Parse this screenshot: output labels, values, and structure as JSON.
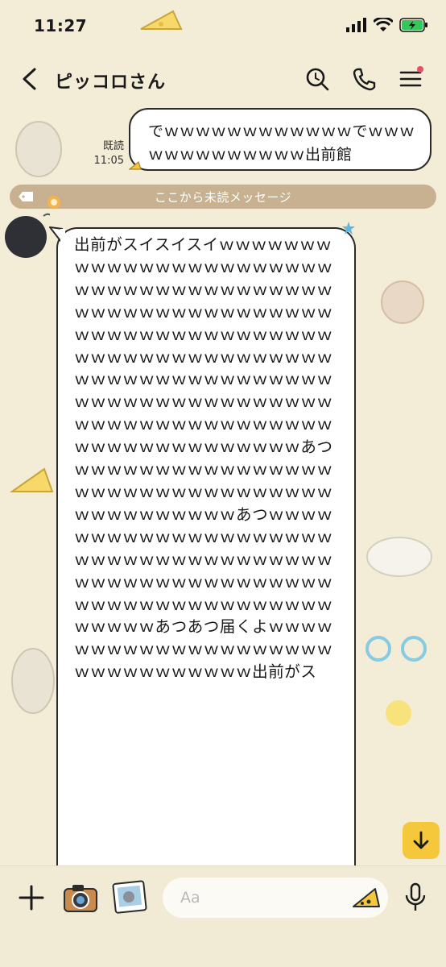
{
  "status_bar": {
    "time": "11:27",
    "battery_color": "#34c759"
  },
  "header": {
    "title": "ピッコロさん",
    "icons": [
      "chevron-left-icon",
      "search-icon",
      "phone-icon",
      "menu-icon"
    ],
    "notification_color": "#e8506a"
  },
  "messages": {
    "sent": {
      "text": "でｗｗｗｗｗｗｗｗｗｗｗｗでｗｗｗｗｗｗｗｗｗｗｗｗｗ出前館",
      "read_label": "既読",
      "time": "11:05"
    },
    "unread_divider": "ここから未読メッセージ",
    "received": {
      "text": "出前がスイスイスイｗｗｗｗｗｗｗｗｗｗｗｗｗｗｗｗｗｗｗｗｗｗｗｗｗｗｗｗｗｗｗｗｗｗｗｗｗｗｗｗｗｗｗｗｗｗｗｗｗｗｗｗｗｗｗｗｗｗｗｗｗｗｗｗｗｗｗｗｗｗｗｗｗｗｗｗｗｗｗｗｗｗｗｗｗｗｗｗｗｗｗｗｗｗｗｗｗｗｗｗｗｗｗｗｗｗｗｗｗｗｗｗｗｗｗｗｗｗｗｗｗｗｗｗｗｗｗｗｗｗｗｗｗｗｗｗｗｗｗｗｗｗｗｗｗｗｗｗｗあつｗｗｗｗｗｗｗｗｗｗｗｗｗｗｗｗｗｗｗｗｗｗｗｗｗｗｗｗｗｗｗｗｗｗｗｗｗｗｗｗｗｗあつｗｗｗｗｗｗｗｗｗｗｗｗｗｗｗｗｗｗｗｗｗｗｗｗｗｗｗｗｗｗｗｗｗｗｗｗｗｗｗｗｗｗｗｗｗｗｗｗｗｗｗｗｗｗｗｗｗｗｗｗｗｗｗｗｗｗｗｗｗｗｗｗｗあつあつ届くよｗｗｗｗｗｗｗｗｗｗｗｗｗｗｗｗｗｗｗｗｗｗｗｗｗｗｗｗｗｗｗ出前がス"
    }
  },
  "input_bar": {
    "placeholder": "Aa",
    "icons": [
      "plus-icon",
      "camera-icon",
      "photo-icon",
      "sticker-icon",
      "mic-icon"
    ],
    "scroll_button_color": "#f5c83c"
  }
}
